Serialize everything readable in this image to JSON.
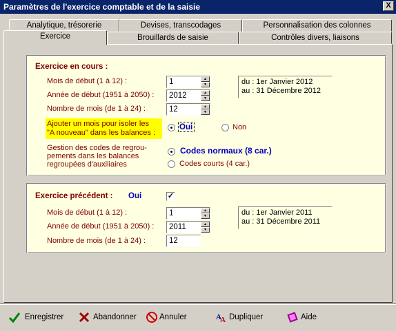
{
  "window": {
    "title": "Paramètres de l'exercice comptable et de la saisie",
    "close_glyph": "X"
  },
  "tabs": {
    "row_back": [
      "Analytique, trésorerie",
      "Devises, transcodages",
      "Personnalisation des colonnes"
    ],
    "row_front": [
      "Exercice",
      "Brouillards de saisie",
      "Contrôles divers, liaisons"
    ],
    "active": "Exercice"
  },
  "current": {
    "title": "Exercice en cours :",
    "start_month_label": "Mois de début (1 à 12)  :",
    "start_month_value": "1",
    "start_year_label": "Année de début (1951 à 2050)  :",
    "start_year_value": "2012",
    "months_label": "Nombre de mois (de 1 à 24)  :",
    "months_value": "12",
    "range_from": "du : 1er Janvier 2012",
    "range_to": "au : 31 Décembre 2012",
    "anouveau_label_line1": "Ajouter un mois pour isoler les",
    "anouveau_label_line2": "\"A nouveau\" dans les balances :",
    "yes": "Oui",
    "no": "Non",
    "grouping_label_line1": "Gestion des codes de regrou-",
    "grouping_label_line2": "pements dans les balances",
    "grouping_label_line3": "regroupées d'auxiliaires",
    "normal_codes": "Codes normaux (8 car.)",
    "short_codes": "Codes courts (4 car.)"
  },
  "previous": {
    "title": "Exercice précédent :",
    "enabled_text": "Oui",
    "enabled_check": "✓",
    "start_month_label": "Mois de début (1 à 12)  :",
    "start_month_value": "1",
    "start_year_label": "Année de début (1951 à 2050)  :",
    "start_year_value": "2011",
    "months_label": "Nombre de mois (de 1 à 24)  :",
    "months_value": "12",
    "range_from": "du : 1er Janvier 2011",
    "range_to": "au : 31 Décembre 2011"
  },
  "buttons": {
    "save": "Enregistrer",
    "abandon": "Abandonner",
    "cancel": "Annuler",
    "duplicate": "Dupliquer",
    "help": "Aide"
  },
  "colors": {
    "label": "#800000",
    "accent_blue": "#0000c0",
    "panel_bg": "#ffffe1",
    "highlight": "#ffff00"
  }
}
